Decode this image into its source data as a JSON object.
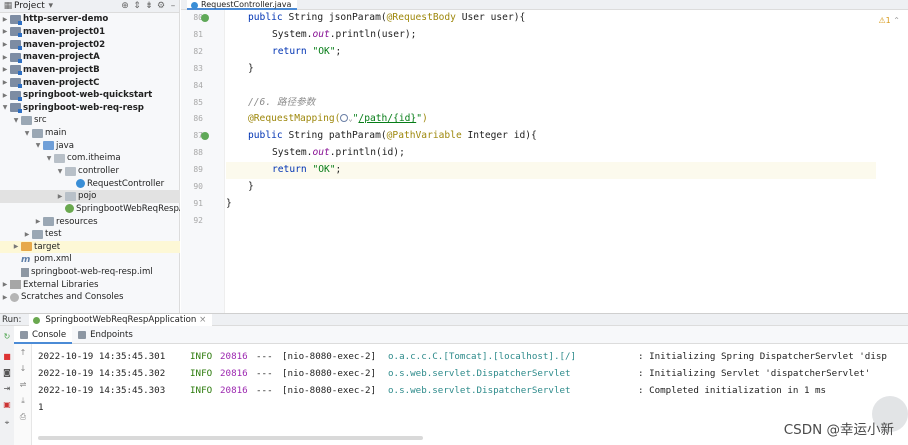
{
  "project_panel": {
    "title": "Project",
    "tree": [
      {
        "label": "http-server-demo",
        "depth": 0,
        "chevron": ">",
        "icon": "module-folder-icon",
        "bold": true
      },
      {
        "label": "maven-project01",
        "depth": 0,
        "chevron": ">",
        "icon": "module-folder-icon",
        "bold": true
      },
      {
        "label": "maven-project02",
        "depth": 0,
        "chevron": ">",
        "icon": "module-folder-icon",
        "bold": true
      },
      {
        "label": "maven-projectA",
        "depth": 0,
        "chevron": ">",
        "icon": "module-folder-icon",
        "bold": true
      },
      {
        "label": "maven-projectB",
        "depth": 0,
        "chevron": ">",
        "icon": "module-folder-icon",
        "bold": true
      },
      {
        "label": "maven-projectC",
        "depth": 0,
        "chevron": ">",
        "icon": "module-folder-icon",
        "bold": true
      },
      {
        "label": "springboot-web-quickstart",
        "depth": 0,
        "chevron": ">",
        "icon": "module-folder-icon",
        "bold": true
      },
      {
        "label": "springboot-web-req-resp",
        "depth": 0,
        "chevron": "v",
        "icon": "module-folder-icon",
        "bold": true
      },
      {
        "label": "src",
        "depth": 1,
        "chevron": "v",
        "icon": "folder-icon",
        "bold": false
      },
      {
        "label": "main",
        "depth": 2,
        "chevron": "v",
        "icon": "folder-icon",
        "bold": false
      },
      {
        "label": "java",
        "depth": 3,
        "chevron": "v",
        "icon": "source-folder-icon",
        "bold": false
      },
      {
        "label": "com.itheima",
        "depth": 4,
        "chevron": "v",
        "icon": "package-icon",
        "bold": false
      },
      {
        "label": "controller",
        "depth": 5,
        "chevron": "v",
        "icon": "package-icon",
        "bold": false
      },
      {
        "label": "RequestController",
        "depth": 6,
        "chevron": "",
        "icon": "class-icon",
        "bold": false
      },
      {
        "label": "pojo",
        "depth": 5,
        "chevron": ">",
        "icon": "package-icon",
        "bold": false,
        "highlight": true
      },
      {
        "label": "SpringbootWebReqRespAp",
        "depth": 5,
        "chevron": "",
        "icon": "spring-class-icon",
        "bold": false
      },
      {
        "label": "resources",
        "depth": 3,
        "chevron": ">",
        "icon": "folder-icon",
        "bold": false
      },
      {
        "label": "test",
        "depth": 2,
        "chevron": ">",
        "icon": "folder-icon",
        "bold": false
      },
      {
        "label": "target",
        "depth": 1,
        "chevron": ">",
        "icon": "excluded-folder-icon",
        "bold": false,
        "selected": true
      },
      {
        "label": "pom.xml",
        "depth": 1,
        "chevron": "",
        "icon": "maven-icon",
        "bold": false
      },
      {
        "label": "springboot-web-req-resp.iml",
        "depth": 1,
        "chevron": "",
        "icon": "iml-file-icon",
        "bold": false
      },
      {
        "label": "External Libraries",
        "depth": 0,
        "chevron": ">",
        "icon": "library-icon",
        "bold": false
      },
      {
        "label": "Scratches and Consoles",
        "depth": 0,
        "chevron": ">",
        "icon": "scratch-icon",
        "bold": false
      }
    ]
  },
  "editor": {
    "tab_label": "RequestController.java",
    "warning_count": "1",
    "info_count": "1",
    "line_numbers": [
      "80",
      "81",
      "82",
      "83",
      "84",
      "85",
      "86",
      "87",
      "88",
      "89",
      "90",
      "91",
      "92"
    ],
    "code": {
      "l80_kw": "public",
      "l80_type": "String",
      "l80_method": "jsonParam(",
      "l80_ann": "@RequestBody",
      "l80_rest": "User user){",
      "l81_a": "System.",
      "l81_out": "out",
      "l81_b": ".println(user);",
      "l82_kw": "return",
      "l82_str": "\"OK\"",
      "l82_end": ";",
      "l83": "}",
      "l85_comment": "//6. 路径参数",
      "l86_ann": "@RequestMapping(",
      "l86_str_open": "\"",
      "l86_path": "/path/{id}",
      "l86_str_close": "\"",
      "l86_end": ")",
      "l87_kw": "public",
      "l87_type": "String",
      "l87_method": "pathParam(",
      "l87_ann": "@PathVariable",
      "l87_rest": "Integer id){",
      "l88_a": "System.",
      "l88_out": "out",
      "l88_b": ".println(id);",
      "l89_kw": "return",
      "l89_str": "\"OK\"",
      "l89_end": ";",
      "l90": "}",
      "l91": "}"
    }
  },
  "run_panel": {
    "label": "Run:",
    "config_name": "SpringbootWebReqRespApplication",
    "tabs": [
      "Console",
      "Endpoints"
    ],
    "logs": [
      {
        "time": "2022-10-19 14:35:45.301",
        "level": "INFO",
        "pid": "20816",
        "sep": "---",
        "thread": "[nio-8080-exec-2]",
        "logger": "o.a.c.c.C.[Tomcat].[localhost].[/]",
        "message": ": Initializing Spring DispatcherServlet 'disp"
      },
      {
        "time": "2022-10-19 14:35:45.302",
        "level": "INFO",
        "pid": "20816",
        "sep": "---",
        "thread": "[nio-8080-exec-2]",
        "logger": "o.s.web.servlet.DispatcherServlet",
        "message": ": Initializing Servlet 'dispatcherServlet'"
      },
      {
        "time": "2022-10-19 14:35:45.303",
        "level": "INFO",
        "pid": "20816",
        "sep": "---",
        "thread": "[nio-8080-exec-2]",
        "logger": "o.s.web.servlet.DispatcherServlet",
        "message": ": Completed initialization in 1 ms"
      },
      {
        "time": "1",
        "level": "",
        "pid": "",
        "sep": "",
        "thread": "",
        "logger": "",
        "message": ""
      }
    ]
  },
  "watermark": "CSDN @幸运小新",
  "colors": {
    "keyword": "#0033b3",
    "annotation": "#9e880d",
    "string": "#067d17",
    "static_field": "#871094",
    "comment": "#8c8c8c",
    "info": "#2b7a0b",
    "pid": "#9c27b0",
    "logger": "#2e8b8b"
  }
}
